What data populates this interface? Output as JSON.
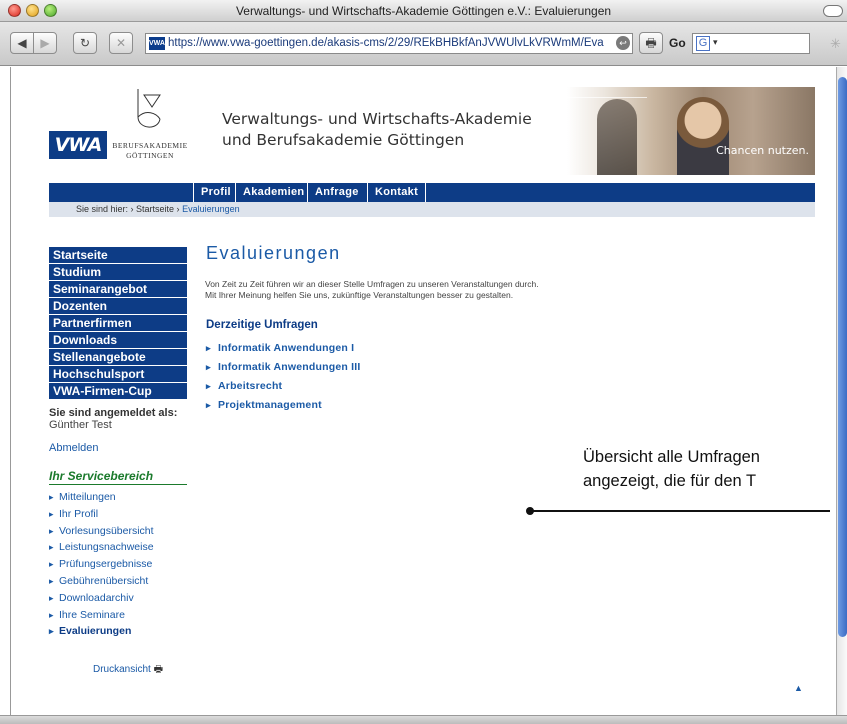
{
  "window": {
    "title": "Verwaltungs- und Wirtschafts-Akademie Göttingen e.V.: Evaluierungen"
  },
  "toolbar": {
    "back_icon": "◀",
    "forward_icon": "▶",
    "reload_icon": "↻",
    "stop_icon": "✕",
    "url": "https://www.vwa-goettingen.de/akasis-cms/2/29/REkBHBkfAnJVWUlvLkVRWmM/Eva",
    "print_icon": "🖶",
    "go_label": "Go",
    "search_engine_icon": "G"
  },
  "header": {
    "logo_text": "VWA",
    "ba_line1": "Berufsakademie",
    "ba_line2": "Göttingen",
    "org_line1": "Verwaltungs- und Wirtschafts-Akademie",
    "org_line2": "und Berufsakademie Göttingen",
    "tagline": "Chancen nutzen."
  },
  "nav": {
    "items": [
      "Profil",
      "Akademien",
      "Anfrage",
      "Kontakt"
    ]
  },
  "breadcrumb": {
    "prefix": "Sie sind hier:  › Startseite  ›",
    "current": "Evaluierungen"
  },
  "sidebar": {
    "items": [
      "Startseite",
      "Studium",
      "Seminarangebot",
      "Dozenten",
      "Partnerfirmen",
      "Downloads",
      "Stellenangebote",
      "Hochschulsport",
      "VWA-Firmen-Cup"
    ],
    "logged_in_label": "Sie sind angemeldet als:",
    "user_name": "Günther Test",
    "logout": "Abmelden",
    "service_title": "Ihr Servicebereich",
    "service_items": [
      "Mitteilungen",
      "Ihr Profil",
      "Vorlesungsübersicht",
      "Leistungsnachweise",
      "Prüfungsergebnisse",
      "Gebührenübersicht",
      "Downloadarchiv",
      "Ihre Seminare",
      "Evaluierungen"
    ],
    "print_label": "Druckansicht"
  },
  "main": {
    "heading": "Evaluierungen",
    "intro_line1": "Von Zeit zu Zeit führen wir an dieser Stelle Umfragen zu unseren Veranstaltungen durch.",
    "intro_line2": "Mit Ihrer Meinung helfen Sie uns, zukünftige Veranstaltungen besser zu gestalten.",
    "subheading": "Derzeitige Umfragen",
    "surveys": [
      "Informatik Anwendungen I",
      "Informatik Anwendungen III",
      "Arbeitsrecht",
      "Projektmanagement"
    ]
  },
  "callout": {
    "line1": "Übersicht alle Umfragen",
    "line2": "angezeigt, die für den T"
  },
  "colors": {
    "brand_blue": "#0d3c86",
    "link_blue": "#1b5aa6",
    "service_green": "#1b7a2c"
  }
}
